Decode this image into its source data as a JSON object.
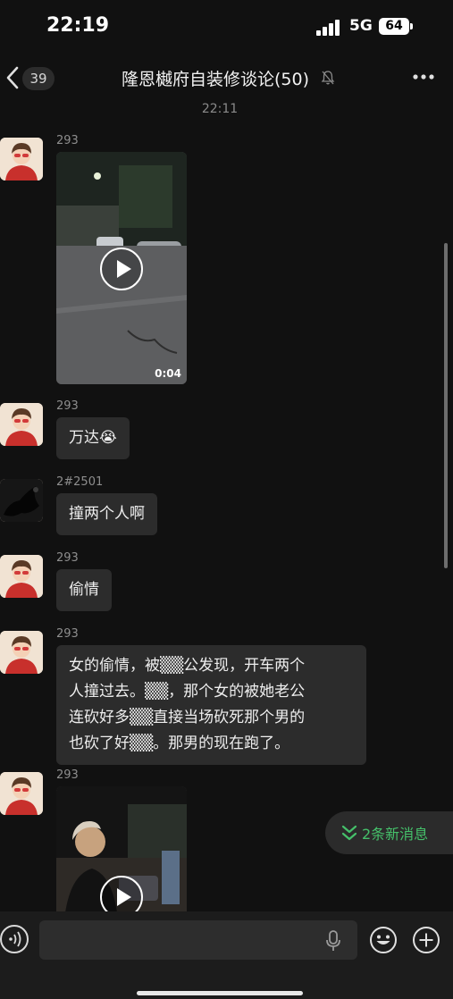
{
  "status_bar": {
    "time": "22:19",
    "network": "5G",
    "battery": "64"
  },
  "nav": {
    "unread_count": "39",
    "title": "隆恩樾府自装修谈论(50)"
  },
  "timestamp": "22:11",
  "messages": [
    {
      "sender": "293",
      "type": "video",
      "duration": "0:04"
    },
    {
      "sender": "293",
      "type": "text",
      "text": "万达😭"
    },
    {
      "sender": "2#2501",
      "type": "text",
      "text": "撞两个人啊"
    },
    {
      "sender": "293",
      "type": "text",
      "text": "偷情"
    },
    {
      "sender": "293",
      "type": "text",
      "lines": [
        "女的偷情，被▒▒公发现，开车两个",
        "人撞过去。▒▒，那个女的被她老公",
        "连砍好多▒▒直接当场砍死那个男的",
        "也砍了好▒▒。那男的现在跑了。"
      ]
    },
    {
      "sender": "293",
      "type": "video"
    }
  ],
  "new_messages": {
    "label": "2条新消息"
  },
  "input": {
    "value": "",
    "placeholder": ""
  },
  "colors": {
    "background": "#111111",
    "bubble": "#2c2c2c",
    "accent_green": "#45c06a"
  }
}
